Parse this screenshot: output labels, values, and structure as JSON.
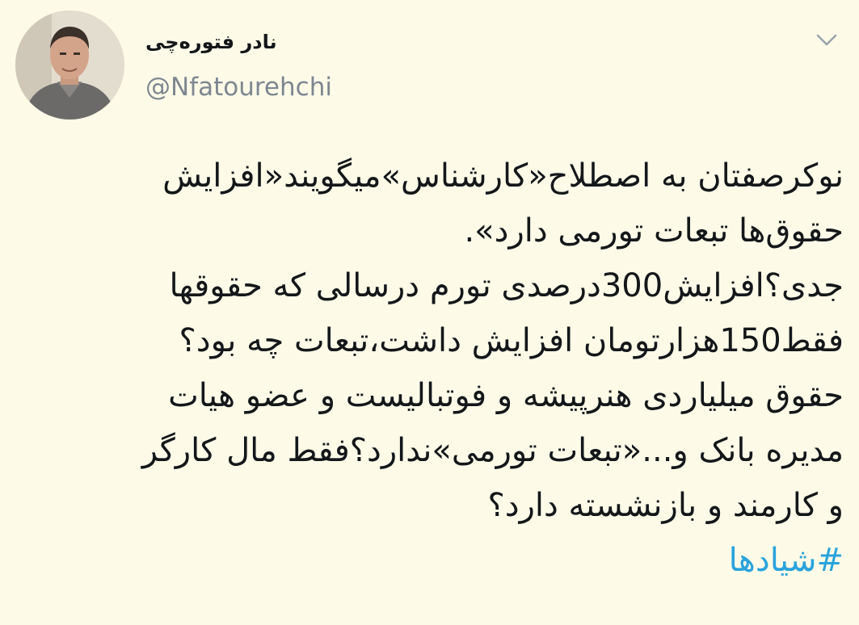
{
  "tweet": {
    "display_name": "نادر فتوره‌چی",
    "handle": "@Nfatourehchi",
    "body_lines": [
      "نوکرصفتان به اصطلاح«کارشناس»میگویند«افزایش",
      "حقوق‌ها تبعات تورمی دارد».",
      "جدی؟افزایش300درصدی تورم درسالی که حقوقها",
      "فقط150هزارتومان افزایش داشت،تبعات چه بود؟",
      "حقوق میلیاردی هنرپیشه و فوتبالیست و عضو هیات",
      "مدیره بانک و...«تبعات تورمی»ندارد؟فقط مال کارگر",
      "و کارمند و بازنشسته دارد؟"
    ],
    "hashtag": "#شیادها"
  },
  "icons": {
    "avatar": "avatar",
    "more": "chevron-down-icon"
  },
  "colors": {
    "background": "#fdfbe8",
    "text": "#14171a",
    "handle": "#7d8791",
    "hashtag": "#2aa3dc"
  }
}
